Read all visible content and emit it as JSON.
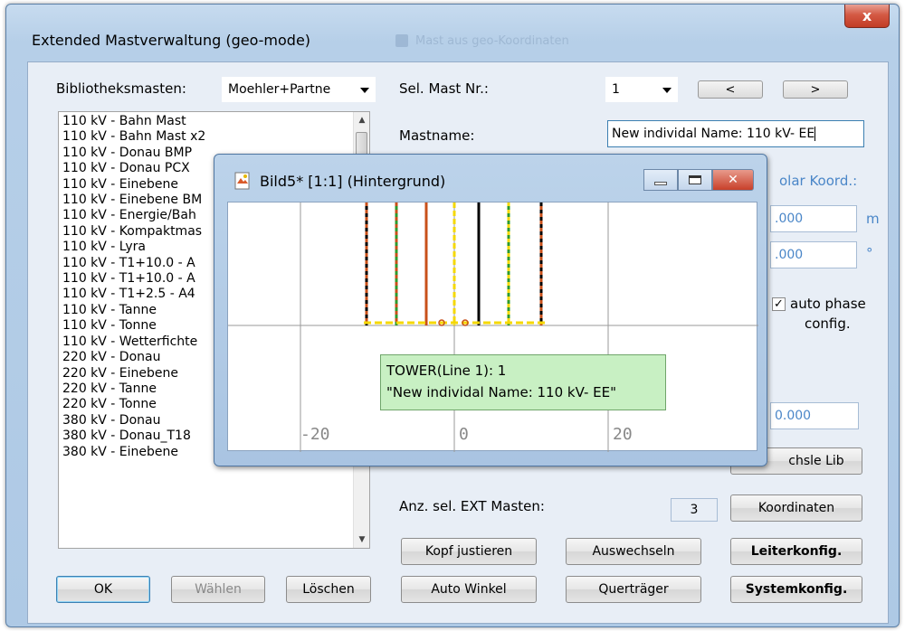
{
  "window": {
    "title": "Extended Mastverwaltung (geo-mode)",
    "close_label": "x",
    "background_title": "Mast aus geo-Koordinaten"
  },
  "left": {
    "library_label": "Bibliotheksmasten:",
    "library_value": "Moehler+Partne",
    "list_items": [
      "110 kV - Bahn Mast",
      "110 kV - Bahn Mast x2",
      "110 kV - Donau BMP",
      "110 kV - Donau PCX",
      "110 kV - Einebene",
      "110 kV - Einebene BM",
      "110 kV - Energie/Bah",
      "110 kV - Kompaktmas",
      "110 kV - Lyra",
      "110 kV - T1+10.0 - A",
      "110 kV - T1+10.0 - A",
      "110 kV - T1+2.5 - A4",
      "110 kV - Tanne",
      "110 kV - Tonne",
      "110 kV - Wetterfichte",
      "220 kV - Donau",
      "220 kV - Einebene",
      "220 kV - Tanne",
      "220 kV - Tonne",
      "380 kV - Donau",
      "380 kV - Donau_T18",
      "380 kV - Einebene"
    ],
    "ok_label": "OK",
    "select_label": "Wählen",
    "delete_label": "Löschen"
  },
  "right": {
    "sel_mast_label": "Sel. Mast Nr.:",
    "sel_mast_value": "1",
    "prev_label": "<",
    "next_label": ">",
    "mastname_label": "Mastname:",
    "mastname_value": "New individal Name: 110 kV- EE",
    "polar_label": "olar Koord.:",
    "radius_value": ".000",
    "radius_unit": "m",
    "angle_value": ".000",
    "angle_unit": "°",
    "auto_phase_line1": "auto phase",
    "auto_phase_line2": "config.",
    "extra_value": "0.000",
    "wechsle_label": "chsle Lib",
    "anz_label": "Anz. sel. EXT Masten:",
    "anz_value": "3",
    "koordinaten_label": "Koordinaten",
    "kopf_label": "Kopf justieren",
    "auswechseln_label": "Auswechseln",
    "leiterkonfig_label": "Leiterkonfig.",
    "auto_winkel_label": "Auto Winkel",
    "quertraeger_label": "Querträger",
    "systemkonfig_label": "Systemkonfig."
  },
  "bild": {
    "title": "Bild5* [1:1] (Hintergrund)",
    "tick_labels": [
      "-20",
      "0",
      "20"
    ],
    "tooltip_line1": "TOWER(Line 1): 1",
    "tooltip_line2": "\"New individal Name: 110 kV- EE\""
  },
  "colors": {
    "conductor_black": "#000000",
    "conductor_orange": "#c8501a",
    "conductor_green": "#2e9a2e",
    "conductor_yellow": "#f5d800"
  }
}
